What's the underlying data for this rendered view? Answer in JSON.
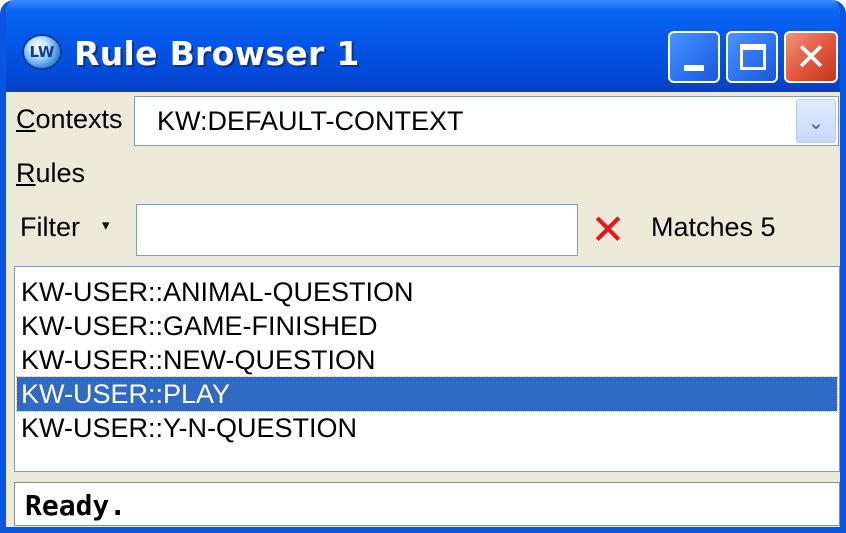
{
  "window": {
    "title": "Rule Browser 1",
    "app_icon": "LW",
    "controls": {
      "minimize_icon": "minimize-icon",
      "maximize_icon": "maximize-icon",
      "close_icon": "close-icon",
      "close_glyph": "✕"
    }
  },
  "contexts": {
    "label_accel": "C",
    "label_rest": "ontexts",
    "selected": "KW:DEFAULT-CONTEXT",
    "dropdown_glyph": "⌄"
  },
  "rules": {
    "label_accel": "R",
    "label_rest": "ules"
  },
  "filter": {
    "label": "Filter",
    "caret": "▾",
    "value": "",
    "clear_glyph": "✕",
    "matches_text": "Matches 5"
  },
  "rule_list": {
    "items": [
      "KW-USER::ANIMAL-QUESTION",
      "KW-USER::GAME-FINISHED",
      "KW-USER::NEW-QUESTION",
      "KW-USER::PLAY",
      "KW-USER::Y-N-QUESTION"
    ],
    "selected_index": 3
  },
  "status": {
    "text": "Ready."
  },
  "colors": {
    "titlebar": "#0455e6",
    "selection": "#316ac5",
    "clear_x": "#e8141c",
    "face": "#ece9d8"
  }
}
